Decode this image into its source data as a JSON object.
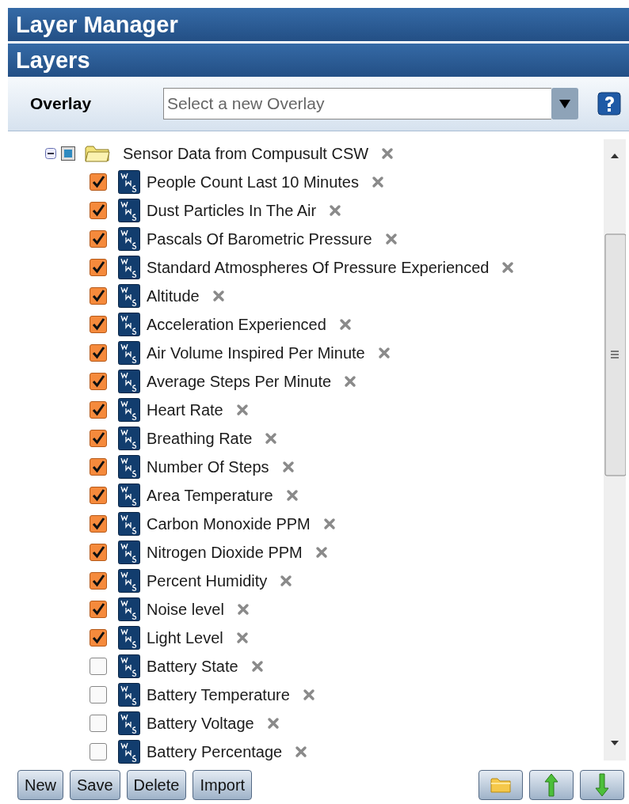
{
  "header": {
    "title": "Layer Manager"
  },
  "section": {
    "title": "Layers"
  },
  "overlay": {
    "label": "Overlay",
    "placeholder": "Select a new Overlay"
  },
  "tree": {
    "group": {
      "label": "Sensor Data from Compusult CSW",
      "expanded": true,
      "partial": true
    },
    "layers": [
      {
        "label": "People Count Last 10 Minutes",
        "checked": true
      },
      {
        "label": "Dust Particles In The Air",
        "checked": true
      },
      {
        "label": "Pascals Of Barometric Pressure",
        "checked": true
      },
      {
        "label": "Standard Atmospheres Of Pressure Experienced",
        "checked": true
      },
      {
        "label": "Altitude",
        "checked": true
      },
      {
        "label": "Acceleration Experienced",
        "checked": true
      },
      {
        "label": "Air Volume Inspired Per Minute",
        "checked": true
      },
      {
        "label": "Average Steps Per Minute",
        "checked": true
      },
      {
        "label": "Heart Rate",
        "checked": true
      },
      {
        "label": "Breathing Rate",
        "checked": true
      },
      {
        "label": "Number Of Steps",
        "checked": true
      },
      {
        "label": "Area Temperature",
        "checked": true
      },
      {
        "label": "Carbon Monoxide PPM",
        "checked": true
      },
      {
        "label": "Nitrogen Dioxide PPM",
        "checked": true
      },
      {
        "label": "Percent Humidity",
        "checked": true
      },
      {
        "label": "Noise level",
        "checked": true
      },
      {
        "label": "Light Level",
        "checked": true
      },
      {
        "label": "Battery State",
        "checked": false
      },
      {
        "label": "Battery Temperature",
        "checked": false
      },
      {
        "label": "Battery Voltage",
        "checked": false
      },
      {
        "label": "Battery Percentage",
        "checked": false
      }
    ]
  },
  "buttons": [
    "New",
    "Save",
    "Delete",
    "Import"
  ]
}
